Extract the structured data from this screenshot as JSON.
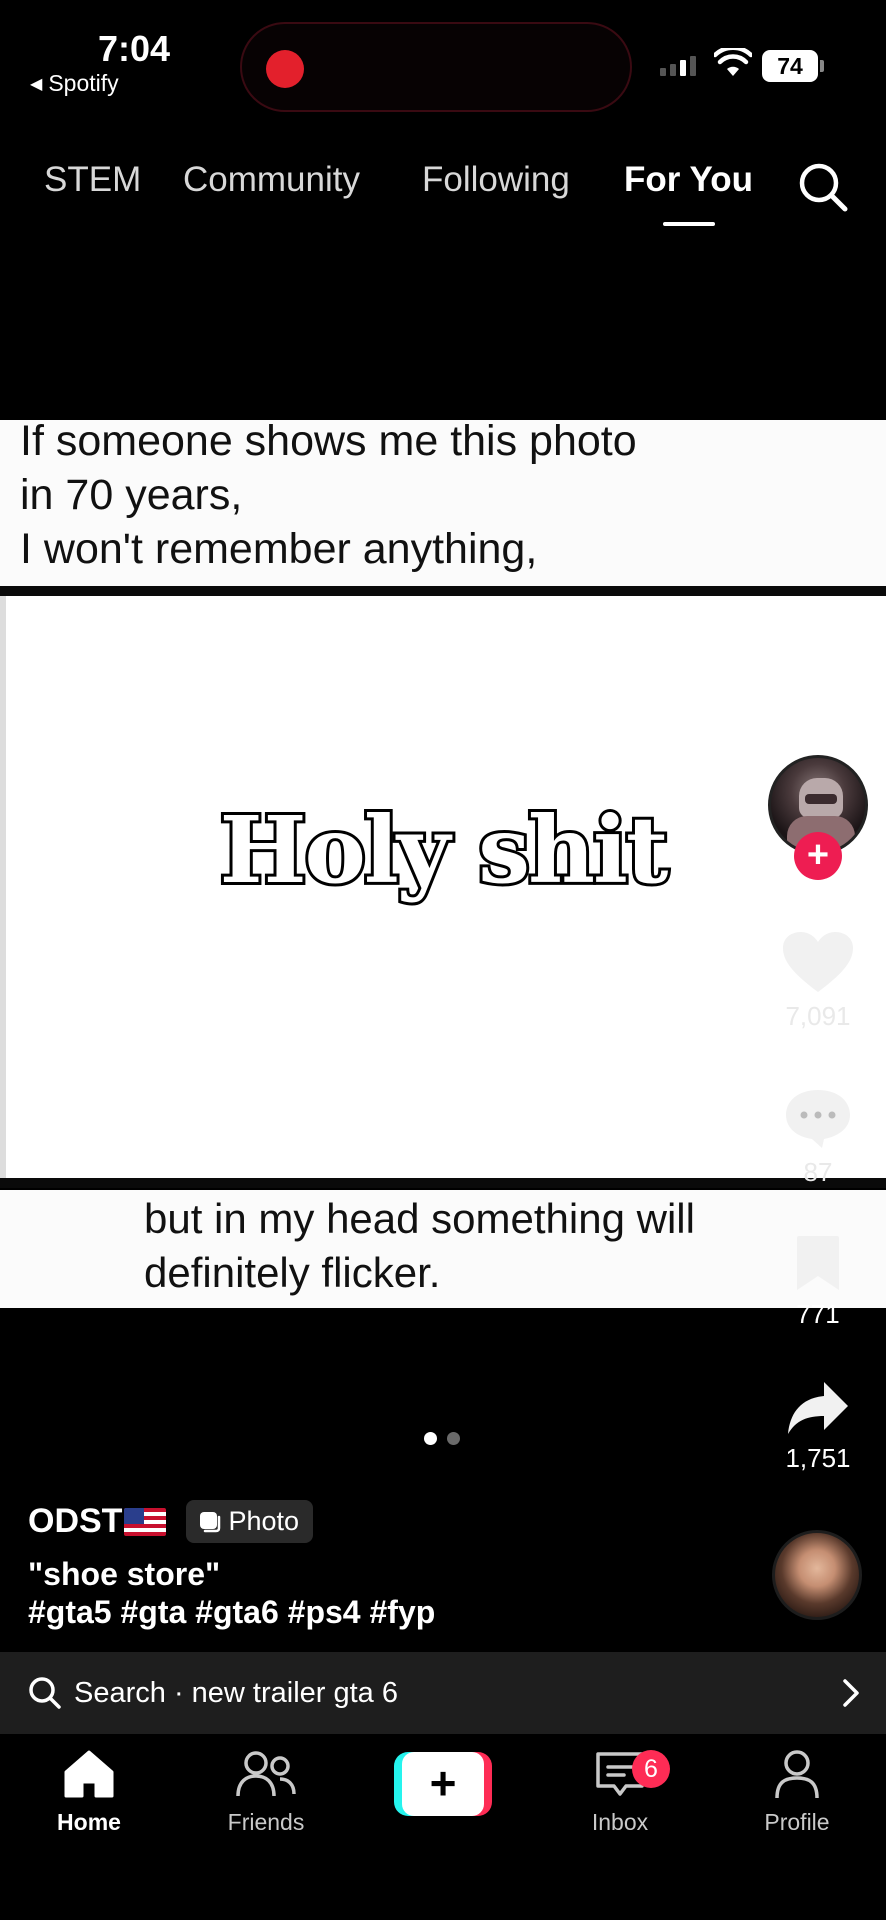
{
  "status_bar": {
    "time": "7:04",
    "back_app": "Spotify",
    "battery": "74"
  },
  "top_tabs": [
    {
      "label": "STEM",
      "active": false
    },
    {
      "label": "Community",
      "active": false
    },
    {
      "label": "Following",
      "active": false
    },
    {
      "label": "For You",
      "active": true
    }
  ],
  "post": {
    "top_caption": "If someone shows me this photo\nin 70 years,\nI won't remember anything,",
    "center_text": "Holy shit",
    "bottom_caption": "but in my head something will\ndefinitely flicker.",
    "photo_page": 1,
    "photo_page_count": 2
  },
  "rail": {
    "likes": "7,091",
    "comments": "87",
    "saves": "771",
    "shares": "1,751"
  },
  "creator": {
    "name": "ODST",
    "flag": "US",
    "type_badge": "Photo",
    "title": "\"shoe store\"",
    "hashtags": "#gta5 #gta #gta6 #ps4 #fyp"
  },
  "search_suggestion": {
    "label": "Search · new trailer gta 6"
  },
  "bottom_nav": {
    "home": "Home",
    "friends": "Friends",
    "inbox": "Inbox",
    "inbox_badge": "6",
    "profile": "Profile",
    "create_symbol": "+"
  },
  "colors": {
    "accent_red": "#fe2c55",
    "accent_cyan": "#25f4ee",
    "record_red": "#e3202c"
  }
}
